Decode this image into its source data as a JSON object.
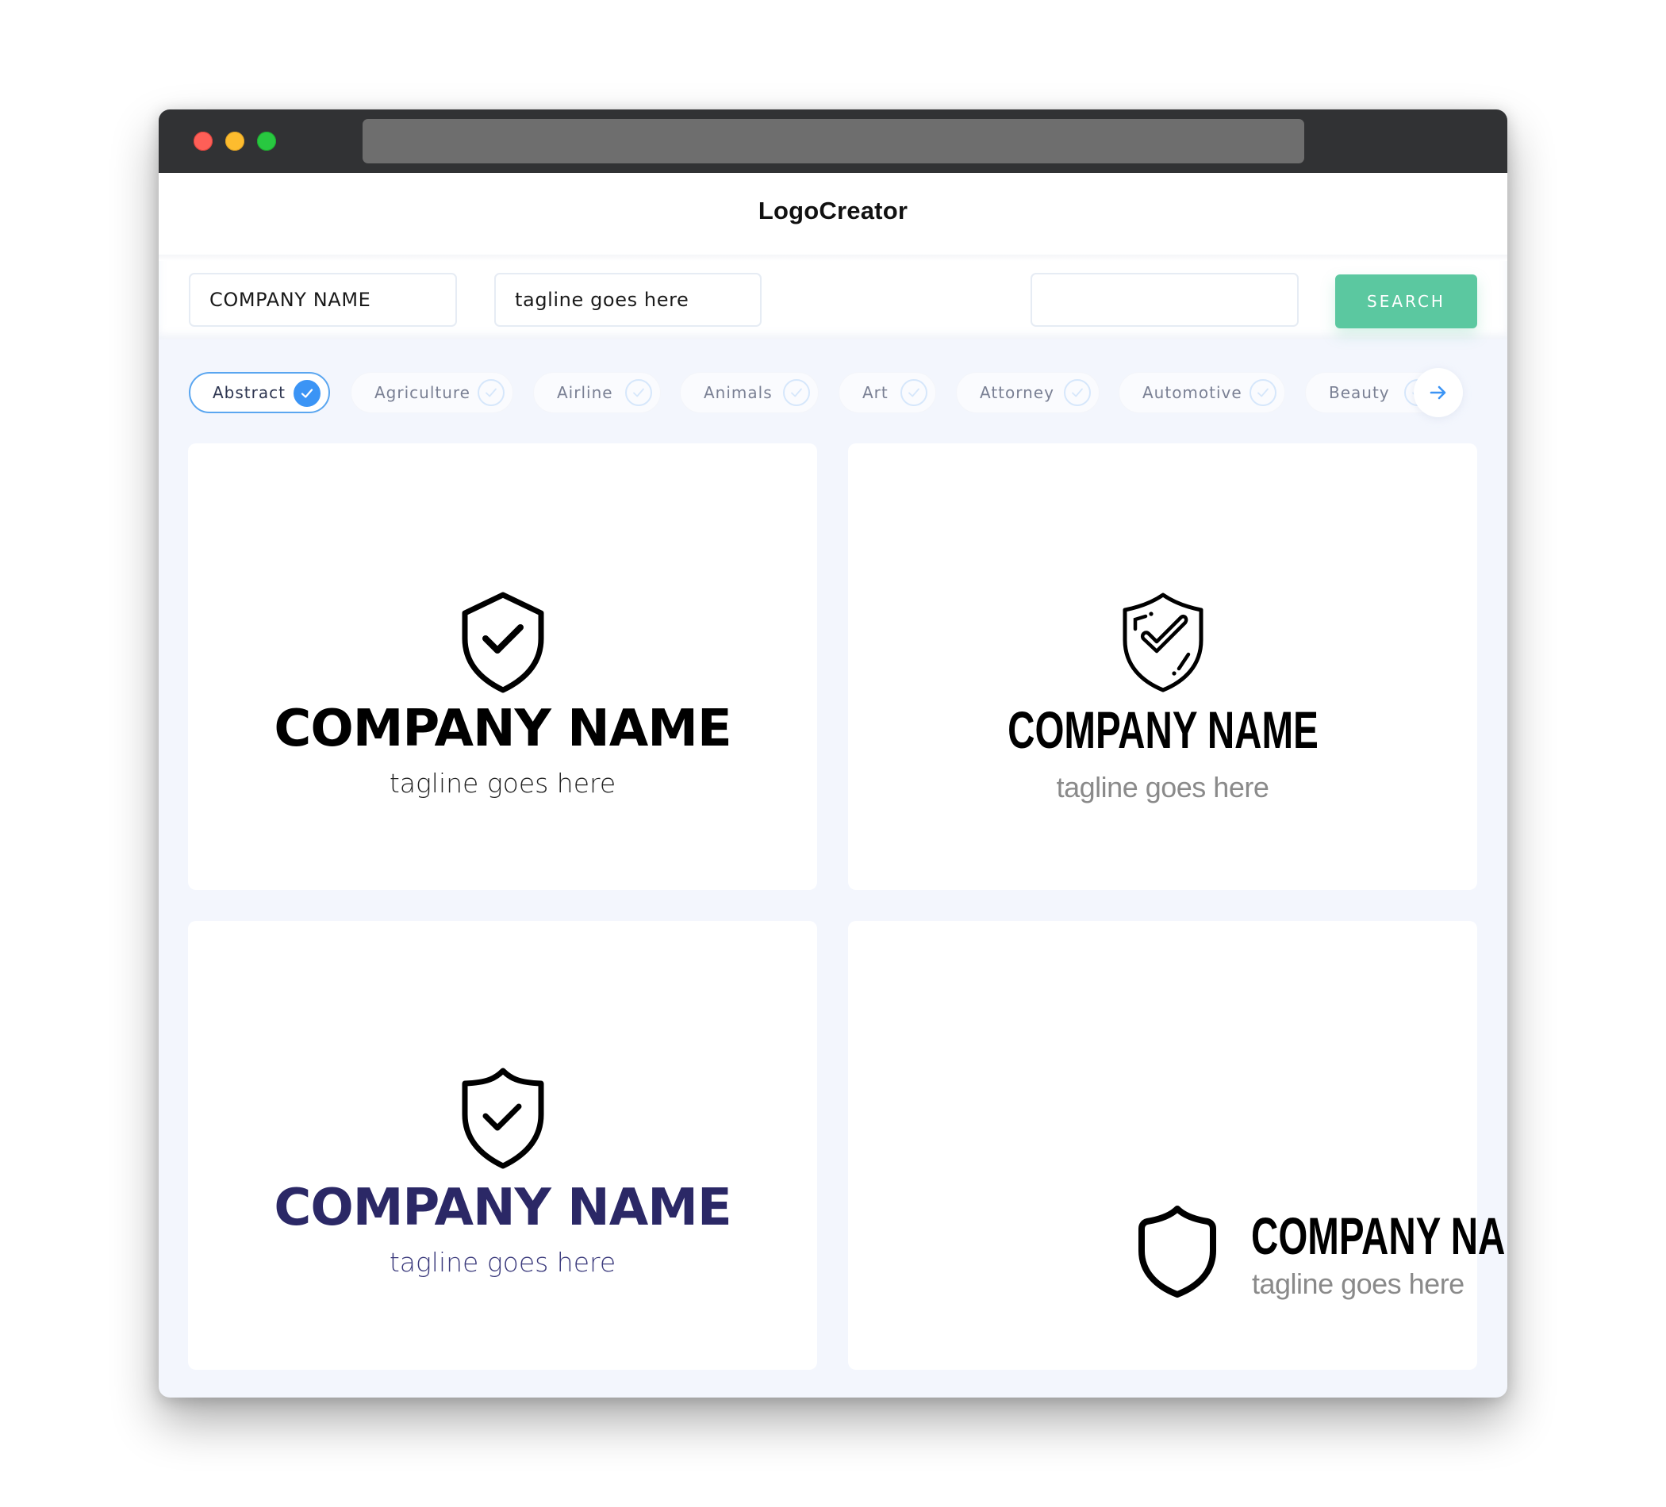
{
  "window": {
    "traffic_lights": [
      "close",
      "minimize",
      "maximize"
    ],
    "address_bar": ""
  },
  "header": {
    "brand": "LogoCreator"
  },
  "search": {
    "company_name_value": "COMPANY NAME",
    "tagline_value": "tagline goes here",
    "extra_value": "",
    "button_label": "SEARCH"
  },
  "categories": {
    "items": [
      {
        "label": "Abstract",
        "selected": true
      },
      {
        "label": "Agriculture",
        "selected": false
      },
      {
        "label": "Airline",
        "selected": false
      },
      {
        "label": "Animals",
        "selected": false
      },
      {
        "label": "Art",
        "selected": false
      },
      {
        "label": "Attorney",
        "selected": false
      },
      {
        "label": "Automotive",
        "selected": false
      },
      {
        "label": "Beauty",
        "selected": false
      }
    ],
    "next_icon": "arrow-right-icon"
  },
  "logos": [
    {
      "company": "COMPANY NAME",
      "tagline": "tagline goes here",
      "icon": "shield-check-icon",
      "layout": "stacked",
      "name_color": "#000000",
      "tagline_color": "#222222"
    },
    {
      "company": "COMPANY NAME",
      "tagline": "tagline goes here",
      "icon": "shield-check-outline-icon",
      "layout": "stacked",
      "name_color": "#000000",
      "tagline_color": "#8A8A8A"
    },
    {
      "company": "COMPANY NAME",
      "tagline": "tagline goes here",
      "icon": "shield-check-icon",
      "layout": "stacked",
      "name_color": "#2B2866",
      "tagline_color": "#3B3A7C"
    },
    {
      "company": "COMPANY NAME",
      "tagline": "tagline goes here",
      "icon": "shield-icon",
      "layout": "horizontal",
      "name_color": "#000000",
      "tagline_color": "#8A8A8A"
    }
  ],
  "colors": {
    "accent_green": "#5BC8A0",
    "accent_blue": "#3B94F5",
    "titlebar": "#313234",
    "page_bg": "#F3F6FD"
  }
}
